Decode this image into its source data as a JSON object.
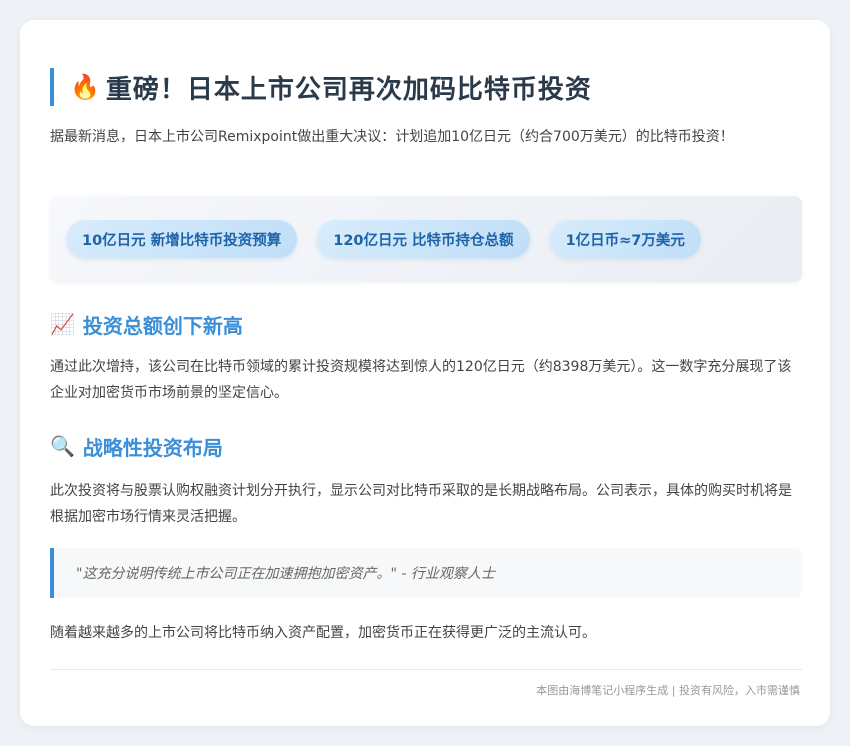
{
  "title": {
    "icon": "fire-icon",
    "icon_glyph": "🔥",
    "text": "重磅！日本上市公司再次加码比特币投资"
  },
  "intro": "据最新消息，日本上市公司Remixpoint做出重大决议：计划追加10亿日元（约合700万美元）的比特币投资！",
  "stats": [
    {
      "label": "10亿日元 新增比特币投资预算"
    },
    {
      "label": "120亿日元 比特币持仓总额"
    },
    {
      "label": "1亿日币≈7万美元"
    }
  ],
  "section1": {
    "icon": "chart-increasing-icon",
    "icon_glyph": "📈",
    "heading": "投资总额创下新高",
    "body": "通过此次增持，该公司在比特币领域的累计投资规模将达到惊人的120亿日元（约8398万美元）。这一数字充分展现了该企业对加密货币市场前景的坚定信心。"
  },
  "section2": {
    "icon": "magnifier-icon",
    "icon_glyph": "🔍",
    "heading": "战略性投资布局",
    "body": "此次投资将与股票认购权融资计划分开执行，显示公司对比特币采取的是长期战略布局。公司表示，具体的购买时机将是根据加密市场行情来灵活把握。"
  },
  "quote": "\"这充分说明传统上市公司正在加速拥抱加密资产。\" - 行业观察人士",
  "closing": "随着越来越多的上市公司将比特币纳入资产配置，加密货币正在获得更广泛的主流认可。",
  "footer": "本图由海博笔记小程序生成 | 投资有风险，入市需谨慎",
  "colors": {
    "accent": "#3b8fd8",
    "title": "#2b3a4a",
    "chip_text": "#1e63a8"
  }
}
